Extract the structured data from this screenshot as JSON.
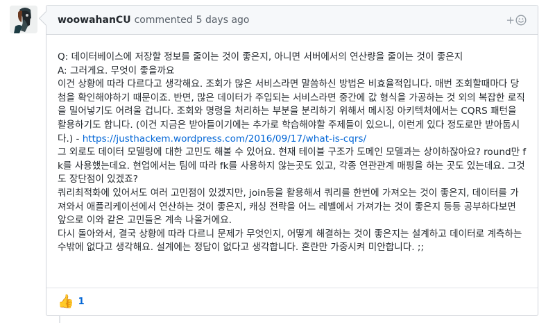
{
  "comment": {
    "author": "woowahanCU",
    "action": "commented",
    "time": "5 days ago",
    "react_icon": "smiley-plus-icon",
    "paragraphs": {
      "q": "Q: 데이터베이스에 저장할 정보를 줄이는 것이 좋은지, 아니면 서버에서의 연산량을 줄이는 것이 좋은지",
      "a": "A: 그러게요. 무엇이 좋을까요",
      "p1_text": "이건 상황에 따라 다르다고 생각해요. 조회가 많은 서비스라면 말씀하신 방법은 비효율적입니다. 매번 조회할때마다 당첨을 확인해야하기 때문이죠. 반면, 많은 데이터가 주입되는 서비스라면 중간에 값 형식을 가공하는 것 외의 복잡한 로직을 밀어넣기도 어려울 겁니다. 조회와 명령을 처리하는 부분을 분리하기 위해서 메시징 아키텍처에서는 CQRS 패턴을 활용하기도 합니다. (이건 지금은 받아들이기에는 추가로 학습해야할 주제들이 있으니, 이런게 있다 정도로만 받아둡시다.) - ",
      "p1_link": "https://justhackem.wordpress.com/2016/09/17/what-is-cqrs/",
      "p2": "그 외로도 데이터 모델링에 대한 고민도 해볼 수 있어요. 현재 테이블 구조가 도메인 모델과는 상이하잖아요? round만 fk를 사용했는데요. 현업에서는 팀에 따라 fk를 사용하지 않는곳도 있고, 각종 연관관계 매핑을 하는 곳도 있는데요. 그것도 장단점이 있겠죠?",
      "p3": "쿼리최적화에 있어서도 여러 고민점이 있겠지만, join등을 활용해서 쿼리를 한번에 가져오는 것이 좋은지, 데이터를 가져와서 애플리케이션에서 연산하는 것이 좋은지, 캐싱 전략을 어느 레벨에서 가져가는 것이 좋은지 등등 공부하다보면 앞으로 이와 같은 고민들은 계속 나올거에요.",
      "p4": "다시 돌아와서, 결국 상황에 따라 다르니 문제가 무엇인지, 어떻게 해결하는 것이 좋은지는 설계하고 데이터로 계측하는 수밖에 없다고 생각해요. 설계에는 정답이 없다고 생각합니다. 혼란만 가중시켜 미안합니다. ;;"
    },
    "reactions": [
      {
        "icon": "thumbs-up-icon",
        "emoji": "👍",
        "count": "1"
      }
    ]
  }
}
